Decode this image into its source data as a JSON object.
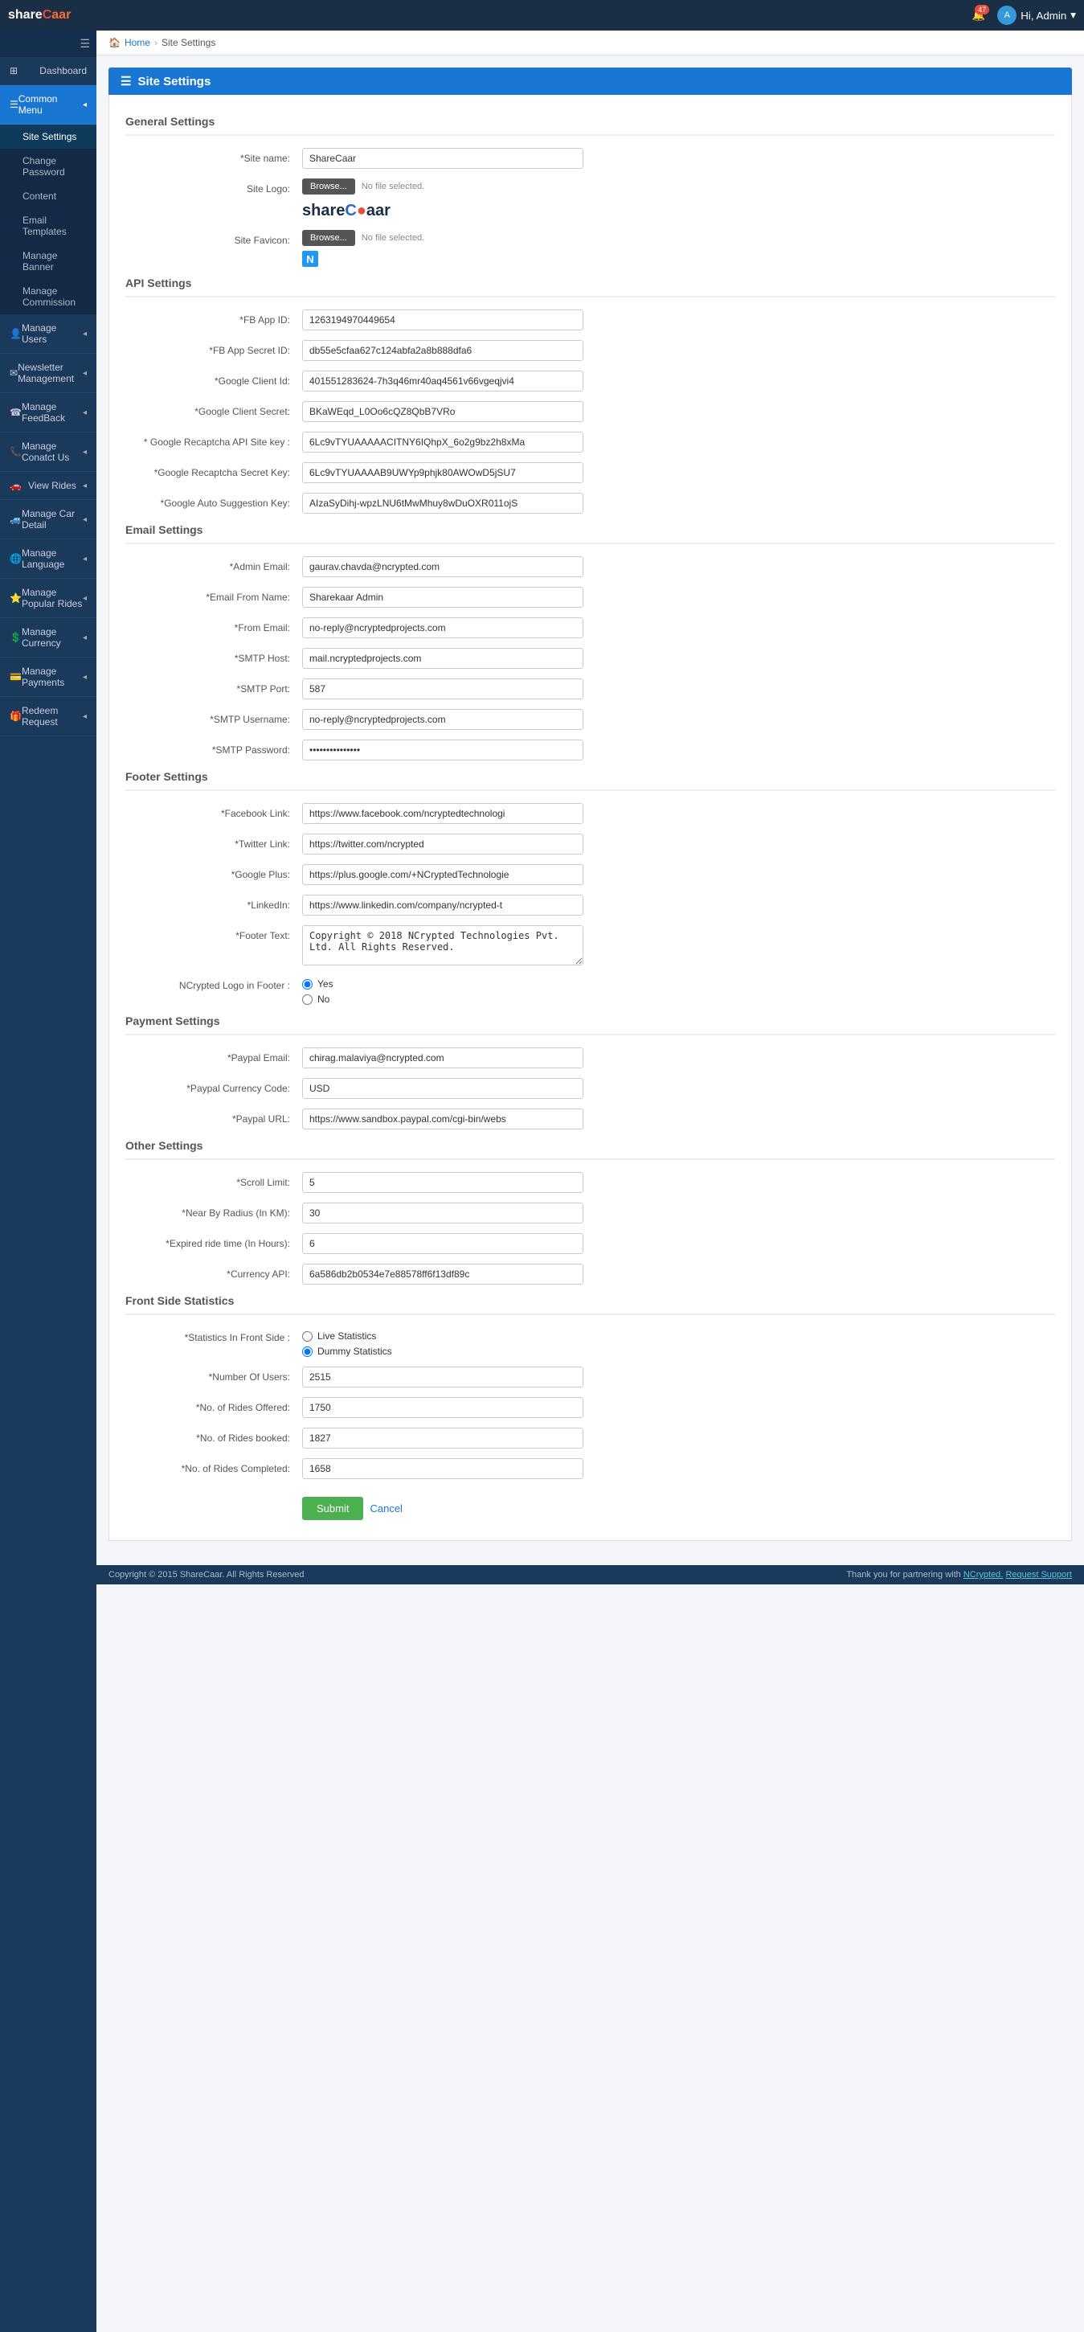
{
  "app": {
    "title": "ShareCaar",
    "logo_text": "share",
    "logo_highlight": "caar",
    "badge_count": "47",
    "user_label": "Hi, Admin",
    "favicon_letter": "N"
  },
  "topnav": {
    "notification_icon": "bell",
    "user_icon": "user",
    "dropdown_icon": "▾"
  },
  "sidebar": {
    "toggle_icon": "☰",
    "items": [
      {
        "id": "dashboard",
        "icon": "⊞",
        "label": "Dashboard",
        "has_sub": false
      },
      {
        "id": "common-menu",
        "icon": "☰",
        "label": "Common Menu",
        "has_sub": true,
        "active": true,
        "highlighted": true
      },
      {
        "id": "manage-users",
        "icon": "👤",
        "label": "Manage Users",
        "has_sub": true
      },
      {
        "id": "newsletter",
        "icon": "✉",
        "label": "Newsletter Management",
        "has_sub": true
      },
      {
        "id": "feedback",
        "icon": "☎",
        "label": "Manage FeedBack",
        "has_sub": true
      },
      {
        "id": "contact",
        "icon": "📞",
        "label": "Manage Conatct Us",
        "has_sub": true
      },
      {
        "id": "view-rides",
        "icon": "🚗",
        "label": "View Rides",
        "has_sub": true
      },
      {
        "id": "car-detail",
        "icon": "🚙",
        "label": "Manage Car Detail",
        "has_sub": true
      },
      {
        "id": "language",
        "icon": "🌐",
        "label": "Manage Language",
        "has_sub": true
      },
      {
        "id": "popular-rides",
        "icon": "⭐",
        "label": "Manage Popular Rides",
        "has_sub": true
      },
      {
        "id": "currency",
        "icon": "💲",
        "label": "Manage Currency",
        "has_sub": true
      },
      {
        "id": "payments",
        "icon": "💳",
        "label": "Manage Payments",
        "has_sub": true
      },
      {
        "id": "redeem",
        "icon": "🎁",
        "label": "Redeem Request",
        "has_sub": true
      }
    ],
    "sub_items": [
      {
        "id": "site-settings",
        "label": "Site Settings",
        "active": true
      },
      {
        "id": "change-password",
        "label": "Change Password"
      },
      {
        "id": "content",
        "label": "Content"
      },
      {
        "id": "email-templates",
        "label": "Email Templates"
      },
      {
        "id": "manage-banner",
        "label": "Manage Banner"
      },
      {
        "id": "manage-commission",
        "label": "Manage Commission"
      }
    ]
  },
  "breadcrumb": {
    "home": "Home",
    "current": "Site Settings"
  },
  "page": {
    "title": "Site Settings",
    "icon": "☰"
  },
  "general_settings": {
    "title": "General Settings",
    "site_name_label": "*Site name:",
    "site_name_value": "ShareCaar",
    "site_logo_label": "Site Logo:",
    "browse_label": "Browse...",
    "no_file_label": "No file selected.",
    "site_favicon_label": "Site Favicon:",
    "logo_display": "shareCaar",
    "favicon_letter": "N"
  },
  "api_settings": {
    "title": "API Settings",
    "fb_app_id_label": "*FB App ID:",
    "fb_app_id_value": "1263194970449654",
    "fb_app_secret_label": "*FB App Secret ID:",
    "fb_app_secret_value": "db55e5cfaa627c124abfa2a8b888dfa6",
    "google_client_id_label": "*Google Client Id:",
    "google_client_id_value": "401551283624-7h3q46mr40aq4561v66vgeqjvi4",
    "google_client_secret_label": "*Google Client Secret:",
    "google_client_secret_value": "BKaWEqd_L0Oo6cQZ8QbB7VRo",
    "google_recaptcha_api_label": "* Google Recaptcha API Site key :",
    "google_recaptcha_api_value": "6Lc9vTYUAAAAACITNY6IQhpX_6o2g9bz2h8xMa",
    "google_recaptcha_secret_label": "*Google Recaptcha Secret Key:",
    "google_recaptcha_secret_value": "6Lc9vTYUAAAAB9UWYp9phjk80AWOwD5jSU7",
    "google_auto_suggestion_label": "*Google Auto Suggestion Key:",
    "google_auto_suggestion_value": "AIzaSyDihj-wpzLNU6tMwMhuy8wDuOXR011ojS"
  },
  "email_settings": {
    "title": "Email Settings",
    "admin_email_label": "*Admin Email:",
    "admin_email_value": "gaurav.chavda@ncrypted.com",
    "email_from_name_label": "*Email From Name:",
    "email_from_name_value": "Sharekaar Admin",
    "from_email_label": "*From Email:",
    "from_email_value": "no-reply@ncryptedprojects.com",
    "smtp_host_label": "*SMTP Host:",
    "smtp_host_value": "mail.ncryptedprojects.com",
    "smtp_port_label": "*SMTP Port:",
    "smtp_port_value": "587",
    "smtp_username_label": "*SMTP Username:",
    "smtp_username_value": "no-reply@ncryptedprojects.com",
    "smtp_password_label": "*SMTP Password:",
    "smtp_password_value": "••••••••••••"
  },
  "footer_settings": {
    "title": "Footer Settings",
    "facebook_link_label": "*Facebook Link:",
    "facebook_link_value": "https://www.facebook.com/ncryptedtechnologi",
    "twitter_link_label": "*Twitter Link:",
    "twitter_link_value": "https://twitter.com/ncrypted",
    "google_plus_label": "*Google Plus:",
    "google_plus_value": "https://plus.google.com/+NCryptedTechnologie",
    "linkedin_label": "*LinkedIn:",
    "linkedin_value": "https://www.linkedin.com/company/ncrypted-t",
    "footer_text_label": "*Footer Text:",
    "footer_text_value": "Copyright © 2018 NCrypted Technologies Pvt. Ltd. All Rights Reserved.",
    "ncrypted_logo_label": "NCrypted Logo in Footer :",
    "yes_label": "Yes",
    "no_label": "No",
    "ncrypted_logo_selected": "yes"
  },
  "payment_settings": {
    "title": "Payment Settings",
    "paypal_email_label": "*Paypal Email:",
    "paypal_email_value": "chirag.malaviya@ncrypted.com",
    "paypal_currency_code_label": "*Paypal Currency Code:",
    "paypal_currency_code_value": "USD",
    "paypal_url_label": "*Paypal URL:",
    "paypal_url_value": "https://www.sandbox.paypal.com/cgi-bin/webs"
  },
  "other_settings": {
    "title": "Other Settings",
    "scroll_limit_label": "*Scroll Limit:",
    "scroll_limit_value": "5",
    "near_by_radius_label": "*Near By Radius (In KM):",
    "near_by_radius_value": "30",
    "expired_ride_label": "*Expired ride time (In Hours):",
    "expired_ride_value": "6",
    "currency_api_label": "*Currency API:",
    "currency_api_value": "6a586db2b0534e7e88578ff6f13df89c"
  },
  "front_stats": {
    "title": "Front Side Statistics",
    "stats_in_front_label": "*Statistics In Front Side :",
    "live_label": "Live Statistics",
    "dummy_label": "Dummy Statistics",
    "selected": "dummy",
    "num_users_label": "*Number Of Users:",
    "num_users_value": "2515",
    "rides_offered_label": "*No. of Rides Offered:",
    "rides_offered_value": "1750",
    "rides_booked_label": "*No. of Rides booked:",
    "rides_booked_value": "1827",
    "rides_completed_label": "*No. of Rides Completed:",
    "rides_completed_value": "1658"
  },
  "actions": {
    "submit_label": "Submit",
    "cancel_label": "Cancel"
  },
  "footer": {
    "copyright": "Copyright © 2015 ShareCaar. All Rights Reserved",
    "thank_you": "Thank you for partnering with",
    "ncrypted": "NCrypted.",
    "request_support": "Request Support"
  }
}
